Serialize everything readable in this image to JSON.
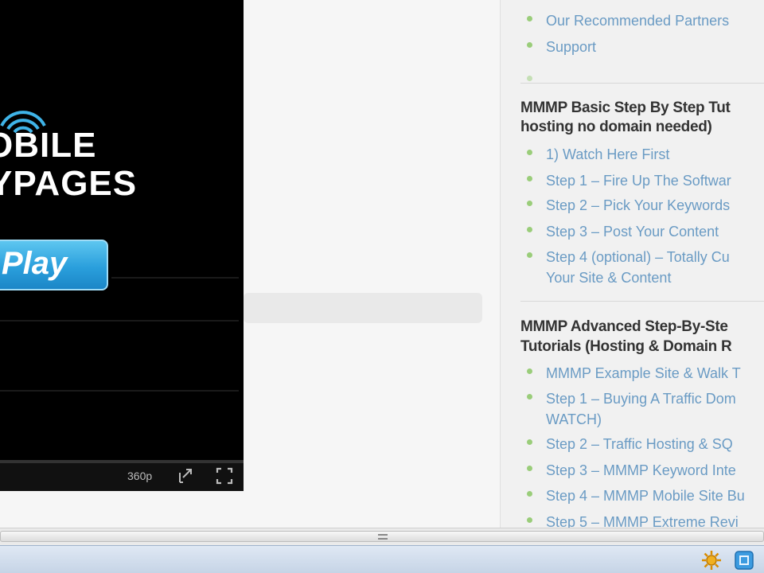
{
  "player": {
    "logo_line1": "OBILE",
    "logo_line2": "YPAGES",
    "play_label": "Play",
    "quality": "360p"
  },
  "sidebar": {
    "top_items": [
      {
        "label": "Our Recommended Partners"
      },
      {
        "label": "Support"
      }
    ],
    "section1": {
      "heading_line1": "MMMP Basic Step By Step Tut",
      "heading_line2": "hosting no domain needed)",
      "items": [
        {
          "label": "1) Watch Here First"
        },
        {
          "label": "Step 1 – Fire Up The Softwar"
        },
        {
          "label": "Step 2 – Pick Your Keywords"
        },
        {
          "label": "Step 3 – Post Your Content"
        },
        {
          "label_line1": "Step 4 (optional) – Totally Cu",
          "label_line2": "Your Site & Content"
        }
      ]
    },
    "section2": {
      "heading_line1": "MMMP Advanced Step-By-Ste",
      "heading_line2": "Tutorials (Hosting & Domain R",
      "items": [
        {
          "label": "MMMP Example Site & Walk T"
        },
        {
          "label_line1": "Step 1 – Buying A Traffic Dom",
          "label_line2": "WATCH)"
        },
        {
          "label": "Step 2 – Traffic Hosting & SQ"
        },
        {
          "label": "Step 3 – MMMP Keyword Inte"
        },
        {
          "label": "Step 4 – MMMP Mobile Site Bu"
        },
        {
          "label": "Step 5 – MMMP Extreme Revi"
        }
      ]
    }
  },
  "colors": {
    "link": "#6a9bc4",
    "bullet": "#9acd7a",
    "heading": "#333333",
    "play_button": "#2a9fdc",
    "player_bg": "#000000"
  },
  "icons": {
    "tray": [
      "gear-sun-icon",
      "app-blue-icon"
    ],
    "player_controls": [
      "popout-icon",
      "fullscreen-icon"
    ]
  }
}
